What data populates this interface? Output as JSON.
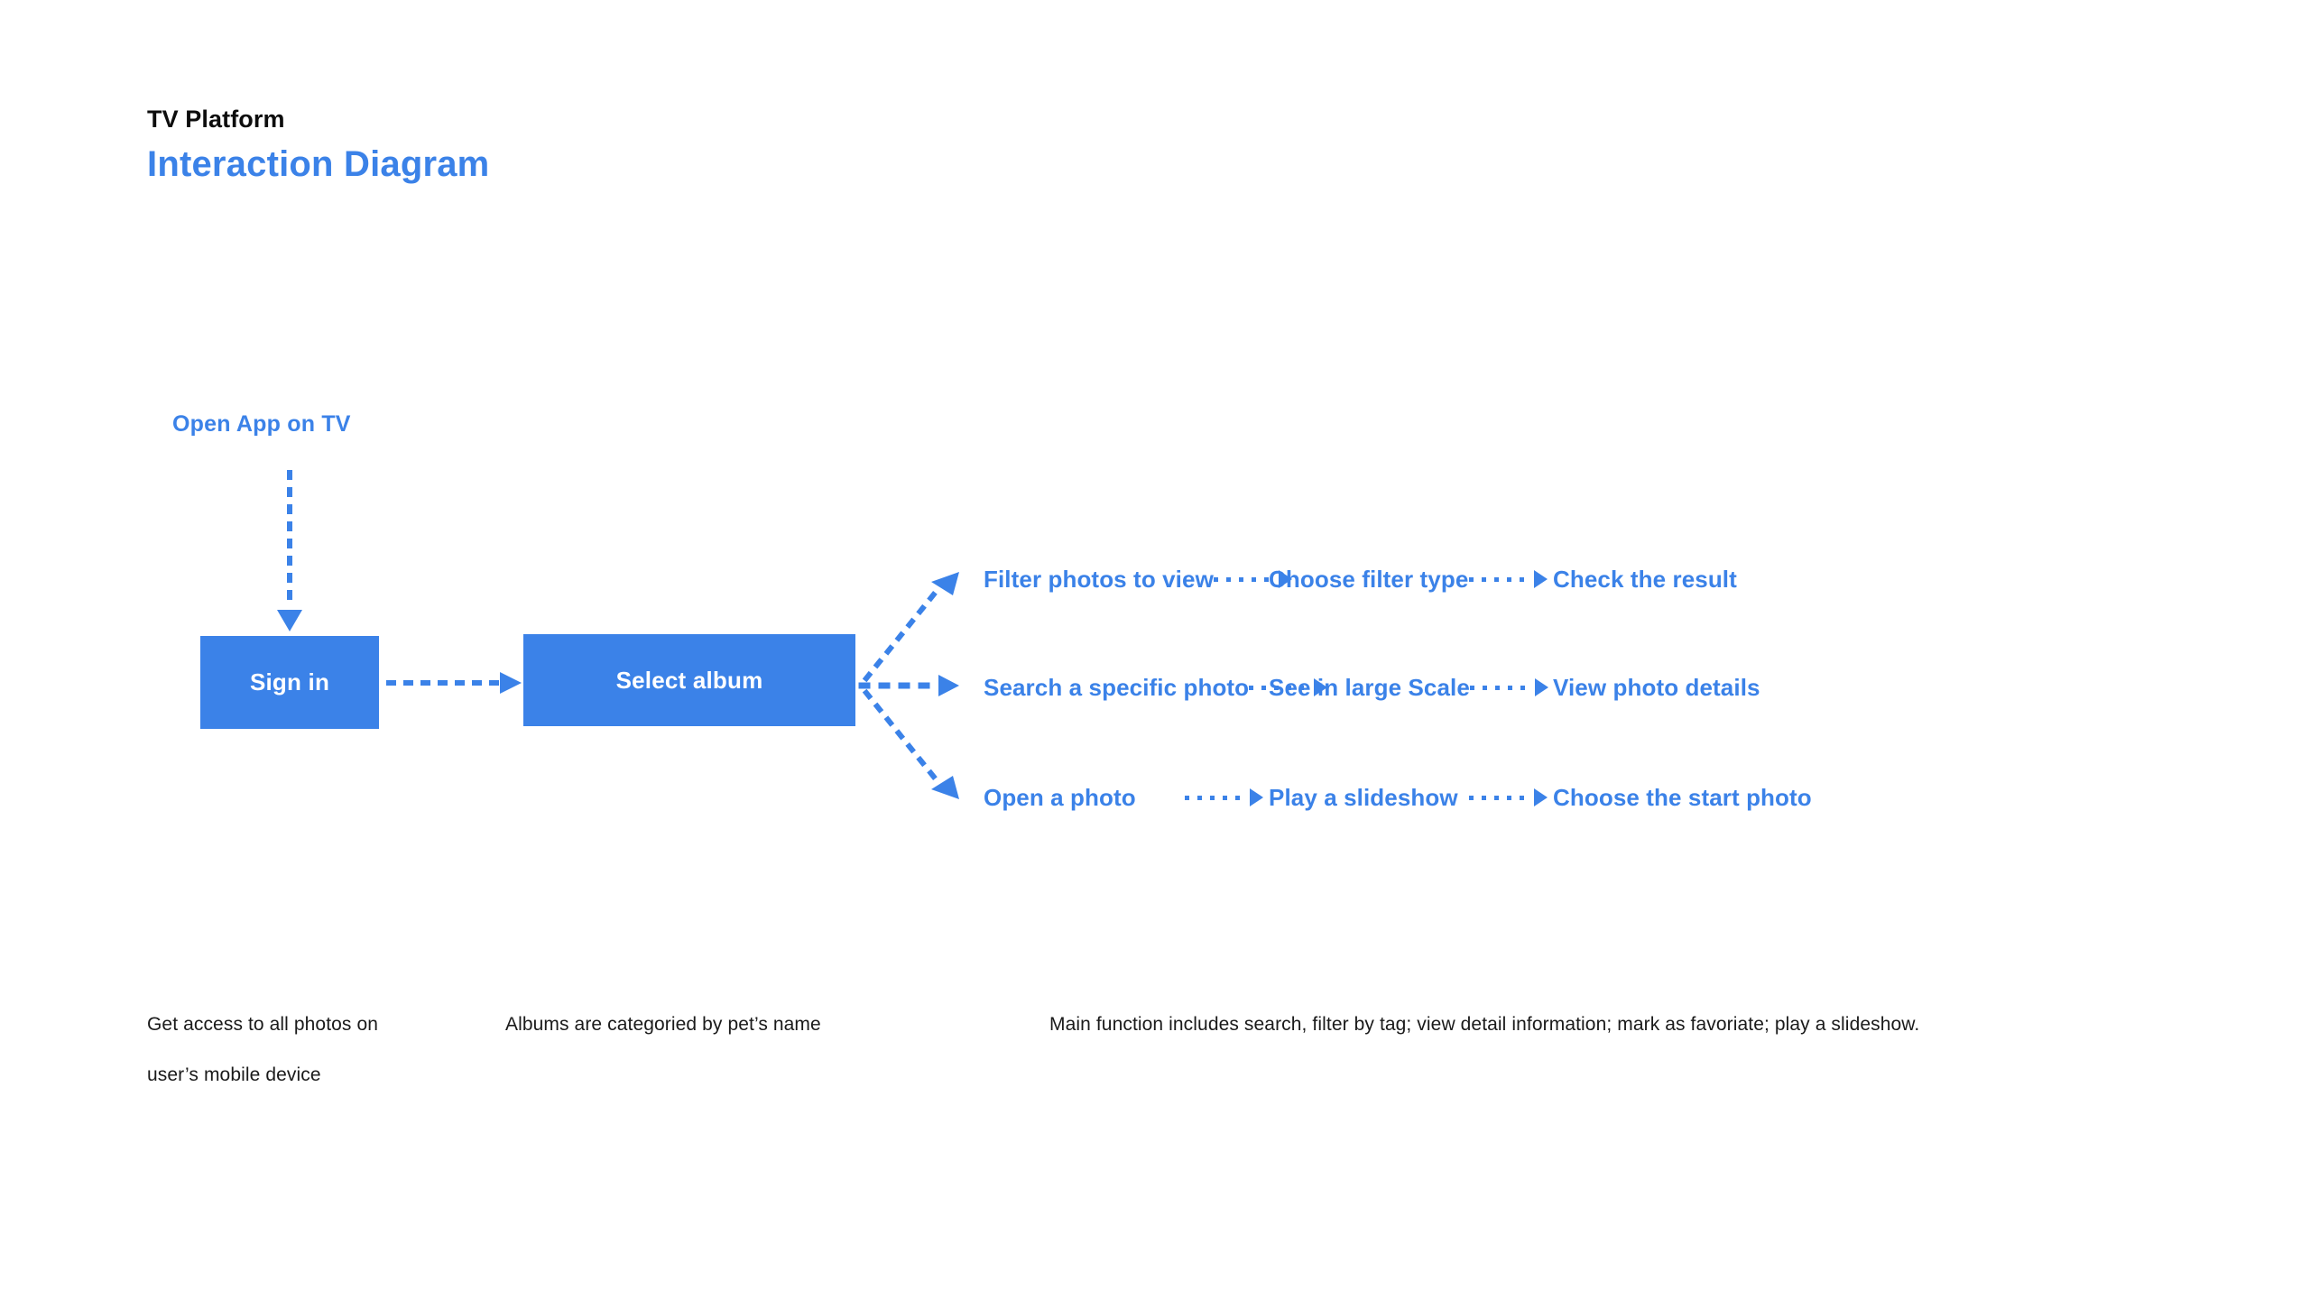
{
  "header": {
    "platform": "TV Platform",
    "title": "Interaction Diagram"
  },
  "accent_color": "#3b82e8",
  "text_color": "#1a1a1a",
  "background_color": "#ffffff",
  "entry": {
    "label": "Open App on TV",
    "arrow_icon": "arrow-down-dotted-icon"
  },
  "boxes": [
    {
      "label": "Sign in"
    },
    {
      "label": "Select album"
    }
  ],
  "connectors": {
    "signin_to_album_icon": "arrow-right-dotted-icon",
    "branch_icon": "arrow-left-triangle-icon",
    "step_icon": "arrow-right-dotted-icon"
  },
  "branches": [
    {
      "steps": [
        "Filter photos to view",
        "Choose filter type",
        "Check the result"
      ]
    },
    {
      "steps": [
        "Search a specific photo",
        "See in large Scale",
        "View photo details"
      ]
    },
    {
      "steps": [
        "Open a photo",
        "Play a slideshow",
        "Choose the start photo"
      ]
    }
  ],
  "captions": [
    "Get access to all photos on user’s mobile device",
    "Albums are categoried by pet’s name",
    "Main function includes search, filter by tag; view detail information; mark as favoriate; play a slideshow."
  ]
}
